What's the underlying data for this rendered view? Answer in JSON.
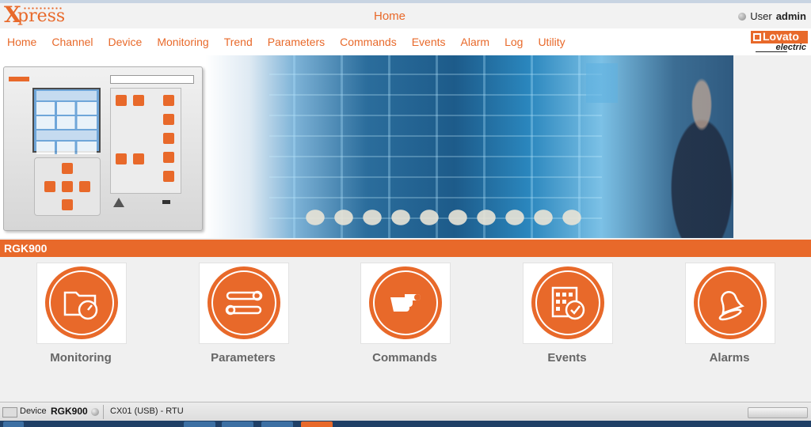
{
  "app": {
    "logo": {
      "x": "X",
      "press": "press"
    },
    "page_title": "Home"
  },
  "user": {
    "label": "User",
    "name": "admin"
  },
  "nav": {
    "items": [
      "Home",
      "Channel",
      "Device",
      "Monitoring",
      "Trend",
      "Parameters",
      "Commands",
      "Events",
      "Alarm",
      "Log",
      "Utility"
    ]
  },
  "brand": {
    "word1": "Lovato",
    "word2": "electric"
  },
  "section": {
    "title": "RGK900"
  },
  "tiles": [
    {
      "label": "Monitoring",
      "icon": "monitoring-gauge-icon"
    },
    {
      "label": "Parameters",
      "icon": "tools-icon"
    },
    {
      "label": "Commands",
      "icon": "pointing-hand-icon"
    },
    {
      "label": "Events",
      "icon": "calendar-clock-icon"
    },
    {
      "label": "Alarms",
      "icon": "bell-icon"
    }
  ],
  "status": {
    "device_label": "Device",
    "device_name": "RGK900",
    "connection": "CX01 (USB) - RTU"
  },
  "colors": {
    "accent": "#e8692a",
    "tile_text": "#666666"
  }
}
